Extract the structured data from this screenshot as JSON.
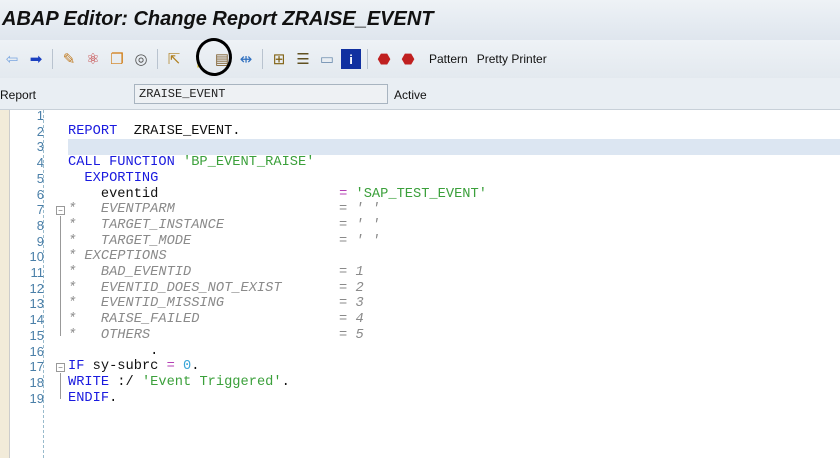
{
  "window": {
    "title": "ABAP Editor: Change Report ZRAISE_EVENT"
  },
  "toolbar": {
    "icons": [
      "back-arrow-icon",
      "forward-arrow-icon",
      "check-icon",
      "activate-icon",
      "other-object-icon",
      "where-used-icon",
      "display-object-list-icon",
      "breakpoint-icon",
      "modify-icon",
      "navigation-icon",
      "object-tree-icon",
      "stack-icon",
      "display-icon",
      "info-icon",
      "stop-icon",
      "stop-user-icon"
    ],
    "pattern_label": "Pattern",
    "pretty_printer_label": "Pretty Printer"
  },
  "report": {
    "label": "Report",
    "value": "ZRAISE_EVENT",
    "status": "Active"
  },
  "code": [
    [],
    [
      {
        "t": "REPORT",
        "c": "kw"
      },
      {
        "t": "  ZRAISE_EVENT.",
        "c": "id"
      }
    ],
    [],
    [
      {
        "t": "CALL FUNCTION ",
        "c": "kw"
      },
      {
        "t": "'BP_EVENT_RAISE'",
        "c": "str"
      }
    ],
    [
      {
        "t": "  EXPORTING",
        "c": "kw"
      }
    ],
    [
      {
        "t": "    eventid                      ",
        "c": "id"
      },
      {
        "t": "= ",
        "c": "op"
      },
      {
        "t": "'SAP_TEST_EVENT'",
        "c": "str"
      }
    ],
    [
      {
        "t": "*   EVENTPARM                    = ' '",
        "c": "cm"
      }
    ],
    [
      {
        "t": "*   TARGET_INSTANCE              = ' '",
        "c": "cm"
      }
    ],
    [
      {
        "t": "*   TARGET_MODE                  = ' '",
        "c": "cm"
      }
    ],
    [
      {
        "t": "* EXCEPTIONS",
        "c": "cm"
      }
    ],
    [
      {
        "t": "*   BAD_EVENTID                  = 1",
        "c": "cm"
      }
    ],
    [
      {
        "t": "*   EVENTID_DOES_NOT_EXIST       = 2",
        "c": "cm"
      }
    ],
    [
      {
        "t": "*   EVENTID_MISSING              = 3",
        "c": "cm"
      }
    ],
    [
      {
        "t": "*   RAISE_FAILED                 = 4",
        "c": "cm"
      }
    ],
    [
      {
        "t": "*   OTHERS                       = 5",
        "c": "cm"
      }
    ],
    [
      {
        "t": "          .",
        "c": "id"
      }
    ],
    [
      {
        "t": "IF ",
        "c": "kw"
      },
      {
        "t": "sy-subrc ",
        "c": "id"
      },
      {
        "t": "= ",
        "c": "op"
      },
      {
        "t": "0",
        "c": "num0"
      },
      {
        "t": ".",
        "c": "id"
      }
    ],
    [
      {
        "t": "WRITE ",
        "c": "kw"
      },
      {
        "t": ":/ ",
        "c": "id"
      },
      {
        "t": "'Event Triggered'",
        "c": "str"
      },
      {
        "t": ".",
        "c": "id"
      }
    ],
    [
      {
        "t": "ENDIF",
        "c": "kw"
      },
      {
        "t": ".",
        "c": "id"
      }
    ]
  ],
  "colors": {
    "keyword": "#1a1adf",
    "string": "#3ba03b",
    "comment": "#8a8a8a",
    "highlight": "#dce6f2"
  }
}
